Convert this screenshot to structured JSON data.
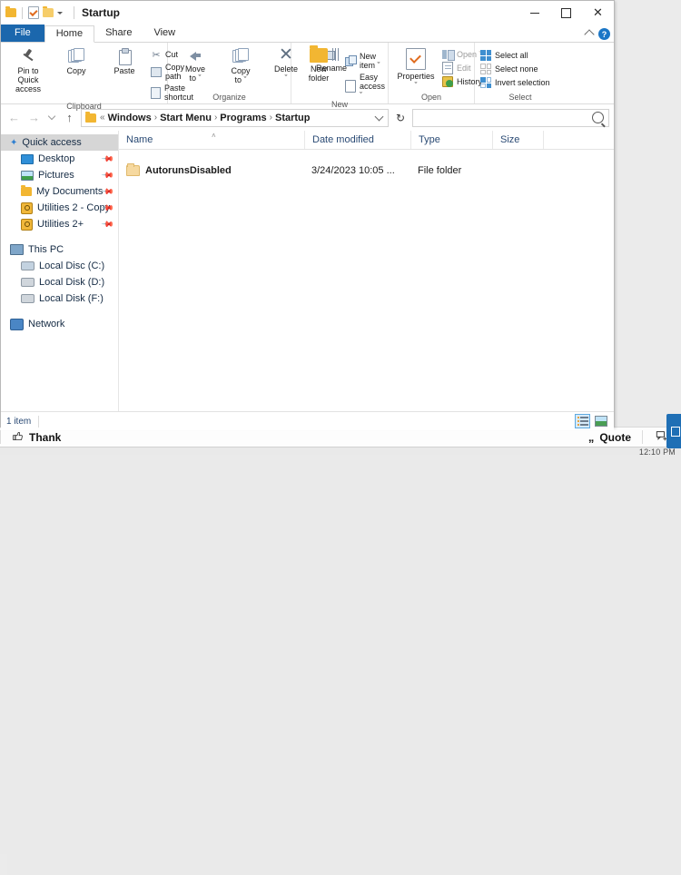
{
  "window": {
    "title": "Startup",
    "quick_access_toolbar": [
      {
        "name": "folder-icon",
        "label": "Properties-folder"
      },
      {
        "name": "properties-icon",
        "label": "Properties"
      },
      {
        "name": "new-folder-icon",
        "label": "New folder"
      },
      {
        "name": "customize-caret",
        "label": "Customize Quick Access Toolbar"
      }
    ],
    "controls": {
      "minimize": "–",
      "maximize": "□",
      "close": "✕"
    },
    "help_label": "?"
  },
  "tabs": [
    {
      "label": "File",
      "state": "file"
    },
    {
      "label": "Home",
      "state": "active"
    },
    {
      "label": "Share",
      "state": "normal"
    },
    {
      "label": "View",
      "state": "normal"
    }
  ],
  "ribbon": {
    "groups": [
      {
        "label": "Clipboard",
        "big": [
          {
            "label": "Pin to Quick\naccess",
            "line1": "Pin to Quick",
            "line2": "access"
          },
          {
            "label": "Copy",
            "line1": "Copy",
            "line2": ""
          },
          {
            "label": "Paste",
            "line1": "Paste",
            "line2": ""
          }
        ],
        "small": [
          {
            "label": "Cut"
          },
          {
            "label": "Copy path"
          },
          {
            "label": "Paste shortcut"
          }
        ]
      },
      {
        "label": "Organize",
        "big": [
          {
            "line1": "Move",
            "line2": "to ˇ"
          },
          {
            "line1": "Copy",
            "line2": "to ˇ"
          },
          {
            "line1": "Delete",
            "line2": "ˇ"
          },
          {
            "line1": "Rename",
            "line2": ""
          }
        ],
        "small": []
      },
      {
        "label": "New",
        "big": [
          {
            "line1": "New",
            "line2": "folder"
          }
        ],
        "small": [
          {
            "label": "New item ˇ"
          },
          {
            "label": "Easy access ˇ"
          }
        ]
      },
      {
        "label": "Open",
        "big": [
          {
            "line1": "Properties",
            "line2": "ˇ"
          }
        ],
        "small": [
          {
            "label": "Open ˇ"
          },
          {
            "label": "Edit"
          },
          {
            "label": "History"
          }
        ]
      },
      {
        "label": "Select",
        "big": [],
        "small": [
          {
            "label": "Select all"
          },
          {
            "label": "Select none"
          },
          {
            "label": "Invert selection"
          }
        ]
      }
    ]
  },
  "navbar": {
    "back": "←",
    "forward": "→",
    "recent_caret": "ˇ",
    "up": "↑",
    "breadcrumb_prefix": "«",
    "breadcrumbs": [
      "Windows",
      "Start Menu",
      "Programs",
      "Startup"
    ],
    "separator": "›",
    "refresh": "↻",
    "search_placeholder": "",
    "search_value": ""
  },
  "nav_pane": {
    "items": [
      {
        "label": "Quick access",
        "icon": "star-icon",
        "selected": true,
        "indent": false,
        "pinned": false
      },
      {
        "label": "Desktop",
        "icon": "desktop-icon",
        "selected": false,
        "indent": true,
        "pinned": true
      },
      {
        "label": "Pictures",
        "icon": "pictures-icon",
        "selected": false,
        "indent": true,
        "pinned": true
      },
      {
        "label": "My Documents",
        "icon": "folder-icon",
        "selected": false,
        "indent": true,
        "pinned": true
      },
      {
        "label": "Utilities 2 - Copy",
        "icon": "utilities-icon",
        "selected": false,
        "indent": true,
        "pinned": true
      },
      {
        "label": "Utilities 2+",
        "icon": "utilities-icon",
        "selected": false,
        "indent": true,
        "pinned": true
      },
      {
        "label": "This PC",
        "icon": "this-pc-icon",
        "selected": false,
        "indent": false,
        "pinned": false
      },
      {
        "label": "Local Disc (C:)",
        "icon": "local-disk-icon",
        "selected": false,
        "indent": true,
        "pinned": false
      },
      {
        "label": "Local Disk (D:)",
        "icon": "local-disk-icon",
        "selected": false,
        "indent": true,
        "pinned": false
      },
      {
        "label": "Local Disk (F:)",
        "icon": "local-disk-icon",
        "selected": false,
        "indent": true,
        "pinned": false
      },
      {
        "label": "Network",
        "icon": "network-icon",
        "selected": false,
        "indent": false,
        "pinned": false
      }
    ]
  },
  "filelist": {
    "columns": [
      "Name",
      "Date modified",
      "Type",
      "Size"
    ],
    "sort_marker": "˄",
    "rows": [
      {
        "name": "AutorunsDisabled",
        "date": "3/24/2023 10:05 ...",
        "type": "File folder",
        "size": ""
      }
    ]
  },
  "statusbar": {
    "item_count": "1 item",
    "views": [
      {
        "name": "details-view",
        "active": true
      },
      {
        "name": "large-icons-view",
        "active": false
      }
    ]
  },
  "forum": {
    "thank_label": "Thank",
    "quote_label": "Quote",
    "multiquote_label": "➕",
    "clock": "12:10 PM"
  }
}
